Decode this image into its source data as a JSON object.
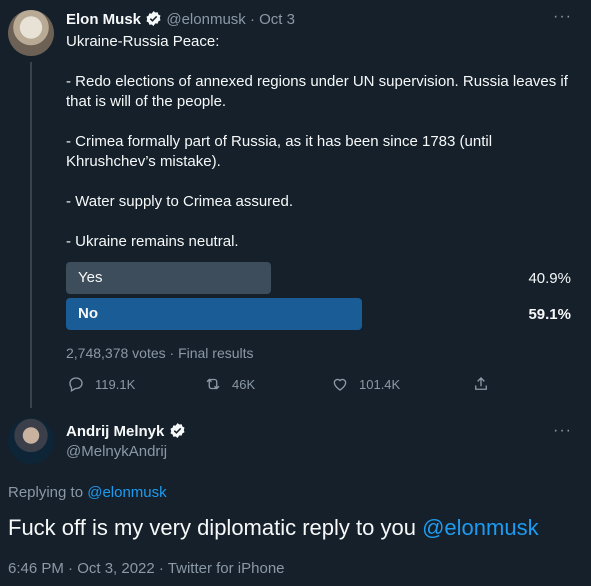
{
  "tweet": {
    "author_name": "Elon Musk",
    "handle": "@elonmusk",
    "separator": "·",
    "date": "Oct 3",
    "more": "···",
    "text": "Ukraine-Russia Peace:\n\n- Redo elections of annexed regions under UN supervision. Russia leaves if that is will of the people.\n\n- Crimea formally part of Russia, as it has been since 1783 (until Khrushchev’s mistake).\n\n- Water supply to Crimea assured.\n\n- Ukraine remains neutral.",
    "poll": {
      "options": [
        {
          "label": "Yes",
          "percent_text": "40.9%",
          "percent": 40.9,
          "winner": false
        },
        {
          "label": "No",
          "percent_text": "59.1%",
          "percent": 59.1,
          "winner": true
        }
      ],
      "summary": "2,748,378 votes · Final results",
      "colors": {
        "bar": "#3e4d5c",
        "winner_bar": "#1a5c95"
      }
    },
    "actions": {
      "replies": "119.1K",
      "retweets": "46K",
      "likes": "101.4K"
    }
  },
  "reply": {
    "author_name": "Andrij Melnyk",
    "handle": "@MelnykAndrij",
    "more": "···",
    "replying_prefix": "Replying to ",
    "replying_to": "@elonmusk",
    "text": "Fuck off is my very diplomatic reply to you ",
    "mention": "@elonmusk",
    "meta": "6:46 PM · Oct 3, 2022 · Twitter for iPhone"
  },
  "colors": {
    "background": "#15202b",
    "accent": "#1d9bf0",
    "muted": "#8b98a5"
  },
  "icons": [
    "verified-badge-icon",
    "reply-icon",
    "retweet-icon",
    "like-icon",
    "share-icon",
    "more-icon"
  ]
}
